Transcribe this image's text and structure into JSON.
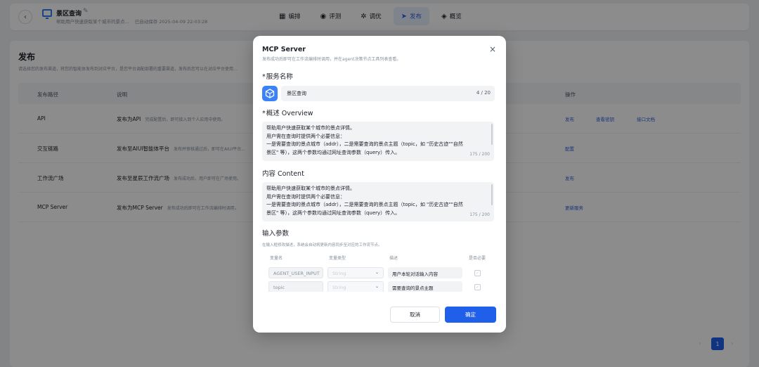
{
  "header": {
    "back_glyph": "‹",
    "app_title": "景区查询",
    "edit_glyph": "✎",
    "app_subtitle": "帮助用户快速获取某个城市的景点...",
    "saved_text": "已自动保存 2025-04-09 22:03:28",
    "nav": [
      {
        "label": "编排",
        "icon": "layout-icon",
        "glyph": "▦",
        "active": false
      },
      {
        "label": "评测",
        "icon": "evaluate-icon",
        "glyph": "◉",
        "active": false
      },
      {
        "label": "调优",
        "icon": "tune-icon",
        "glyph": "✲",
        "active": false
      },
      {
        "label": "发布",
        "icon": "publish-icon",
        "glyph": "➤",
        "active": true
      },
      {
        "label": "概览",
        "icon": "overview-icon",
        "glyph": "◈",
        "active": false
      }
    ]
  },
  "page": {
    "title": "发布",
    "desc": "请选择您的发布渠道，将您的智能体发布到对应平台，是您平台调配部署的重要渠道，发布后您可以在对应平台使用...",
    "columns": {
      "path": "发布路径",
      "desc": "说明",
      "ops": "操作"
    },
    "rows": [
      {
        "path": "API",
        "title": "发布为API",
        "note": "完成配置后，即可接入到个人应用中使用。",
        "actions": [
          "发布",
          "查看密钥",
          "接口文档"
        ]
      },
      {
        "path": "交互链路",
        "title": "发布至AIUI智能体平台",
        "note": "发布并审核通过后，即可在AIUI平台...",
        "actions": [
          "配置"
        ]
      },
      {
        "path": "工作流广场",
        "title": "发布至星辰工作流广场",
        "note": "发布成功后，用户即可在广场使用。",
        "actions": [
          "发布"
        ]
      },
      {
        "path": "MCP Server",
        "title": "发布为MCP Server",
        "note": "发布成功后即可在工作流编排时调用。",
        "actions": [
          "更新服务"
        ]
      }
    ],
    "pager": {
      "prev": "‹",
      "current": "1",
      "next": "›"
    }
  },
  "modal": {
    "title": "MCP Server",
    "subtitle": "发布成功后即可在工作流编排时调用，并在agent决策节点工具列表查看。",
    "close_glyph": "×",
    "service_name_label": "服务名称",
    "service_name_value": "景区查询",
    "service_name_count": "4 / 20",
    "overview_label": "概述 Overview",
    "overview_lines": [
      "帮助用户快速获取某个城市的景点详情。",
      "用户需在查询时提供两个必要信息：",
      "一是需要查询的景点城市（addr），二是需要查询的景点主题（topic，如 \"历史古迹\"\"自然",
      "景区\" 等），这两个参数均通过网址查询参数（query）传入。"
    ],
    "overview_count": "175 / 200",
    "content_label": "内容 Content",
    "content_lines": [
      "帮助用户快速获取某个城市的景点详情。",
      "用户需在查询时提供两个必要信息：",
      "一是需要查询的景点城市（addr），二是需要查询的景点主题（topic，如 \"历史古迹\"\"自然",
      "景区\" 等），这两个参数均通过网址查询参数（query）传入。"
    ],
    "content_count": "175 / 200",
    "params_label": "输入参数",
    "params_desc": "在输入框修改描述，系统会自动将更新内容同步至对应的工作流节点。",
    "params_headers": {
      "name": "变量名",
      "type": "变量类型",
      "desc": "描述",
      "required": "是否必要"
    },
    "params": [
      {
        "name": "AGENT_USER_INPUT",
        "type": "String",
        "desc": "用户本轮对话输入内容",
        "required": true
      },
      {
        "name": "topic",
        "type": "String",
        "desc": "需要查询的景点主题",
        "required": true
      }
    ],
    "cancel_label": "取消",
    "confirm_label": "确定"
  }
}
